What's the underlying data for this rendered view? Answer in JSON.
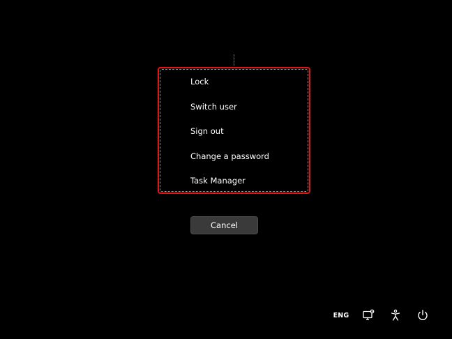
{
  "security_options": {
    "items": [
      {
        "label": "Lock"
      },
      {
        "label": "Switch user"
      },
      {
        "label": "Sign out"
      },
      {
        "label": "Change a password"
      },
      {
        "label": "Task Manager"
      }
    ],
    "highlight_color": "#e01515"
  },
  "cancel": {
    "label": "Cancel"
  },
  "tray": {
    "language": "ENG",
    "icons": [
      "network-icon",
      "accessibility-icon",
      "power-icon"
    ]
  },
  "colors": {
    "background": "#000000",
    "text": "#ffffff",
    "button_bg": "#3a3a3a"
  }
}
